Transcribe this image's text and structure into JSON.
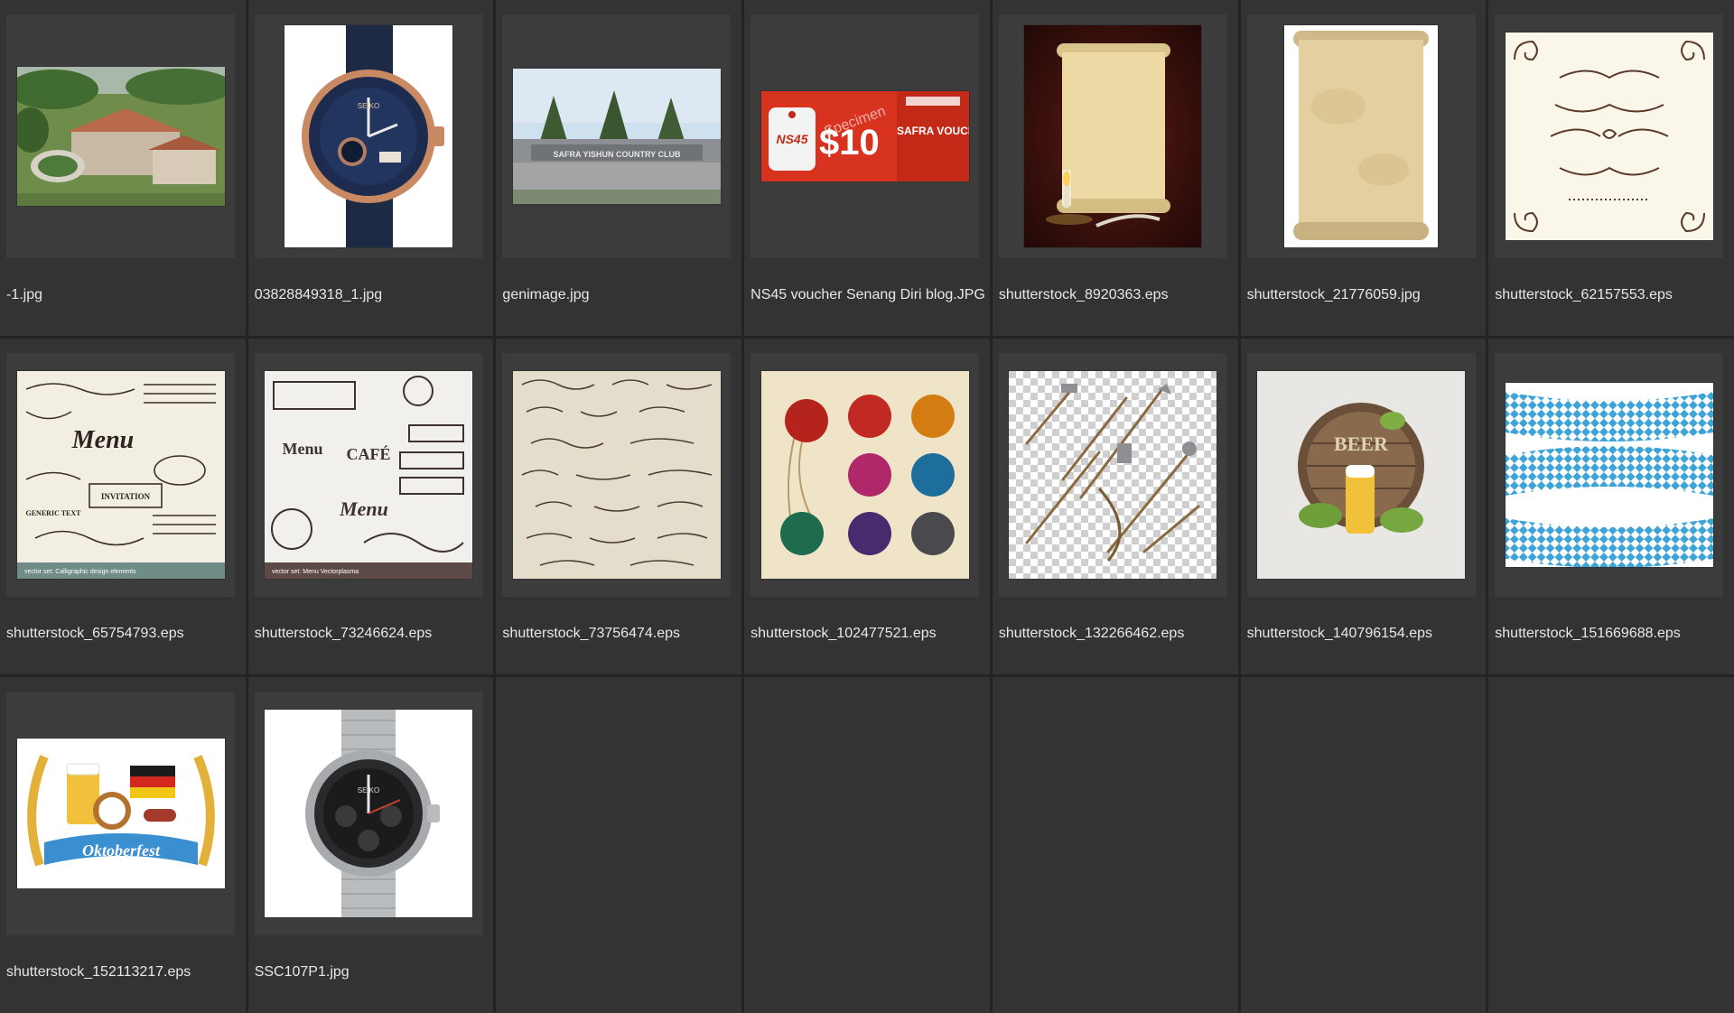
{
  "browser": {
    "files": [
      {
        "name": "-1.jpg",
        "thumb": "aerial-clubhouse"
      },
      {
        "name": "03828849318_1.jpg",
        "thumb": "rose-gold-watch"
      },
      {
        "name": "genimage.jpg",
        "thumb": "country-club-entrance"
      },
      {
        "name": "NS45 voucher Senang Diri blog.JPG",
        "thumb": "voucher"
      },
      {
        "name": "shutterstock_8920363.eps",
        "thumb": "scroll-candle"
      },
      {
        "name": "shutterstock_21776059.jpg",
        "thumb": "parchment-scroll"
      },
      {
        "name": "shutterstock_62157553.eps",
        "thumb": "ornate-frame"
      },
      {
        "name": "shutterstock_65754793.eps",
        "thumb": "calligraphic-elements"
      },
      {
        "name": "shutterstock_73246624.eps",
        "thumb": "menu-cafe-elements"
      },
      {
        "name": "shutterstock_73756474.eps",
        "thumb": "swirl-ornaments"
      },
      {
        "name": "shutterstock_102477521.eps",
        "thumb": "wax-seals"
      },
      {
        "name": "shutterstock_132266462.eps",
        "thumb": "medieval-weapons"
      },
      {
        "name": "shutterstock_140796154.eps",
        "thumb": "beer-barrel"
      },
      {
        "name": "shutterstock_151669688.eps",
        "thumb": "bavarian-ribbon"
      },
      {
        "name": "shutterstock_152113217.eps",
        "thumb": "oktoberfest-badge"
      },
      {
        "name": "SSC107P1.jpg",
        "thumb": "steel-watch"
      }
    ],
    "thumb_text": {
      "voucher_amount": "$10",
      "voucher_brand": "NS45",
      "voucher_title": "SAFRA VOUCHER",
      "voucher_stamp": "Specimen",
      "club_sign": "SAFRA YISHUN COUNTRY CLUB",
      "vector_set_1": "vector set: Calligraphic design elements",
      "vector_set_2": "vector set: Menu Vectorplasma",
      "menu_word": "Menu",
      "cafe_word": "CAFÉ",
      "invitation_word": "INVITATION",
      "generic_text": "GENERIC TEXT",
      "beer_word": "BEER",
      "oktoberfest_word": "Oktoberfest",
      "watch_brand": "SEIKO"
    }
  }
}
